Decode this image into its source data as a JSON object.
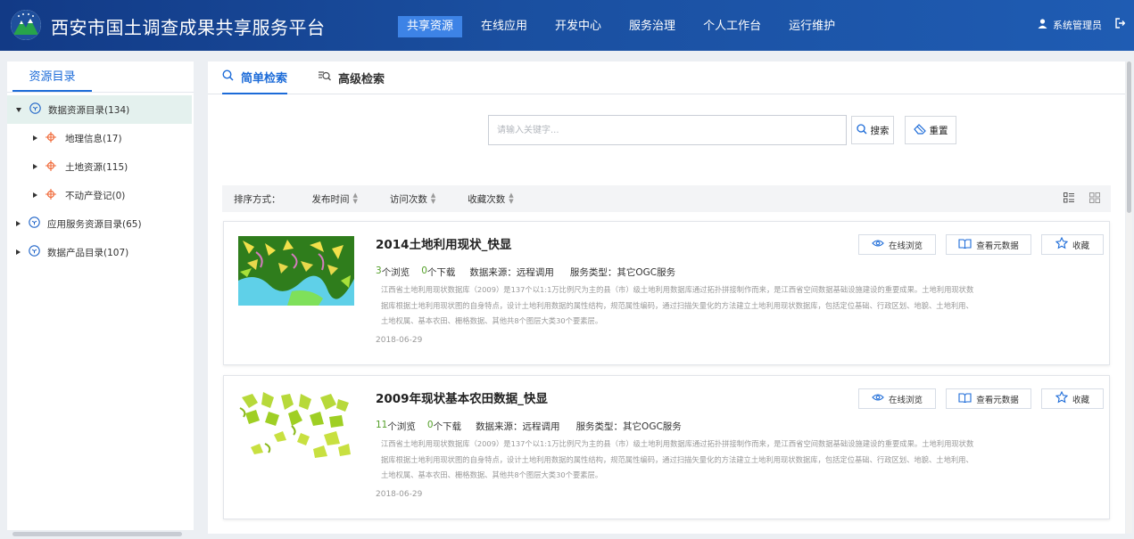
{
  "header": {
    "title": "西安市国土调查成果共享服务平台",
    "nav": [
      "共享资源",
      "在线应用",
      "开发中心",
      "服务治理",
      "个人工作台",
      "运行维护"
    ],
    "active_nav": "共享资源",
    "user": "系统管理员",
    "colors": {
      "bar": "#1a4fa0",
      "active": "#3d83e6"
    }
  },
  "sidebar": {
    "tab": "资源目录",
    "tree": [
      {
        "label": "数据资源目录(134)",
        "level": 0,
        "expanded": true,
        "selected": true,
        "icon": "cube-icon"
      },
      {
        "label": "地理信息(17)",
        "level": 1,
        "expanded": false,
        "icon": "crosshair-icon"
      },
      {
        "label": "土地资源(115)",
        "level": 1,
        "expanded": false,
        "icon": "crosshair-icon"
      },
      {
        "label": "不动产登记(0)",
        "level": 1,
        "expanded": false,
        "icon": "crosshair-icon"
      },
      {
        "label": "应用服务资源目录(65)",
        "level": 0,
        "expanded": false,
        "icon": "cube-icon"
      },
      {
        "label": "数据产品目录(107)",
        "level": 0,
        "expanded": false,
        "icon": "cube-icon"
      }
    ]
  },
  "tabs": {
    "simple": "简单检索",
    "advanced": "高级检索"
  },
  "search": {
    "placeholder": "请输入关键字...",
    "search_label": "搜索",
    "reset_label": "重置"
  },
  "sort": {
    "label": "排序方式：",
    "items": [
      "发布时间",
      "访问次数",
      "收藏次数"
    ]
  },
  "cards": [
    {
      "title": "2014土地利用现状_快显",
      "views": "3",
      "views_label": "个浏览",
      "downloads": "0",
      "downloads_label": "个下载",
      "source": "数据来源：远程调用",
      "service_type": "服务类型：其它OGC服务",
      "desc": "江西省土地利用现状数据库（2009）是137个以1:1万比例尺为主的县（市）级土地利用数据库通过拓扑拼接制作而来，是江西省空间数据基础设施建设的重要成果。土地利用现状数据库根据土地利用现状图的自身特点，设计土地利用数据的属性结构，规范属性编码，通过扫描矢量化的方法建立土地利用现状数据库，包括定位基础、行政区划、地貌、土地利用、土地权属、基本农田、栅格数据、其他共8个图层大类30个要素层。",
      "date": "2018-06-29",
      "btn_view": "在线浏览",
      "btn_meta": "查看元数据",
      "btn_fav": "收藏"
    },
    {
      "title": "2009年现状基本农田数据_快显",
      "views": "11",
      "views_label": "个浏览",
      "downloads": "0",
      "downloads_label": "个下载",
      "source": "数据来源：远程调用",
      "service_type": "服务类型：其它OGC服务",
      "desc": "江西省土地利用现状数据库（2009）是137个以1:1万比例尺为主的县（市）级土地利用数据库通过拓扑拼接制作而来，是江西省空间数据基础设施建设的重要成果。土地利用现状数据库根据土地利用现状图的自身特点，设计土地利用数据的属性结构，规范属性编码，通过扫描矢量化的方法建立土地利用现状数据库，包括定位基础、行政区划、地貌、土地利用、土地权属、基本农田、栅格数据、其他共8个图层大类30个要素层。",
      "date": "2018-06-29",
      "btn_view": "在线浏览",
      "btn_meta": "查看元数据",
      "btn_fav": "收藏"
    }
  ]
}
